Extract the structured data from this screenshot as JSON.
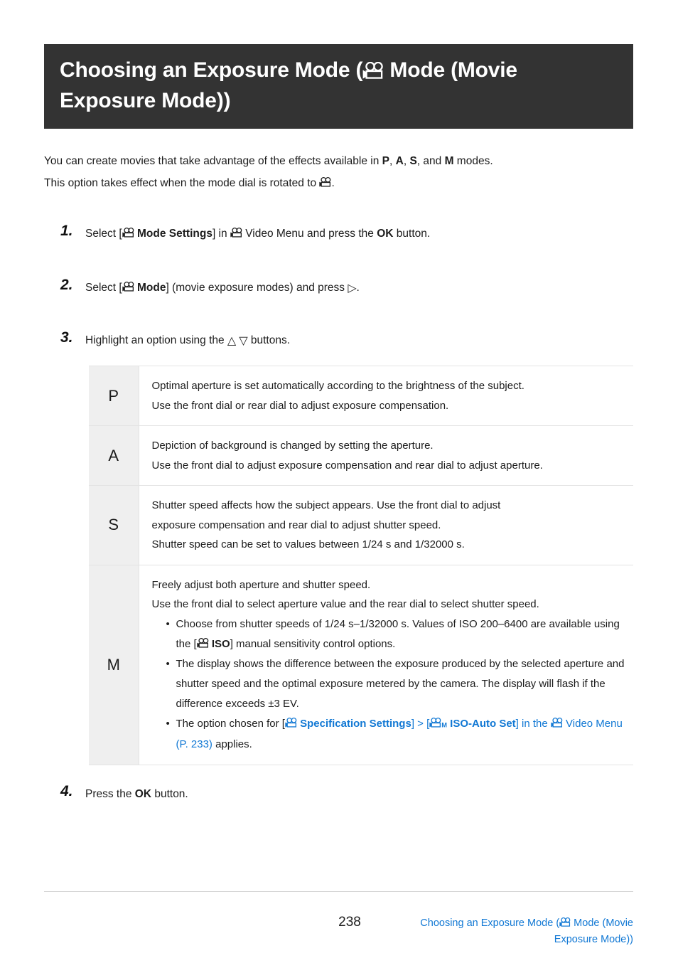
{
  "title": {
    "part1": "Choosing an Exposure Mode (",
    "icon": "movie-camera-icon",
    "part2": " Mode (Movie Exposure Mode))"
  },
  "intro": {
    "line1_a": "You can create movies that take advantage of the effects available in ",
    "mode_p": "P",
    "sep1": ", ",
    "mode_a": "A",
    "sep2": ", ",
    "mode_s": "S",
    "sep3": ", and ",
    "mode_m": "M",
    "line1_b": " modes.",
    "line2_a": "This option takes effect when the mode dial is rotated to ",
    "line2_b": "."
  },
  "steps": [
    {
      "number": "1.",
      "a": "Select [",
      "b": "Mode Settings",
      "c": "] in ",
      "d": " Video Menu and press the ",
      "e": "OK",
      "f": " button."
    },
    {
      "number": "2.",
      "a": "Select [",
      "b": "Mode",
      "c": "] (movie exposure modes) and press ",
      "d": "▷",
      "e": "."
    },
    {
      "number": "3.",
      "a": "Highlight an option using the ",
      "up": "△",
      "down": "▽",
      "b": " buttons."
    },
    {
      "number": "4.",
      "a": "Press the ",
      "b": "OK",
      "c": " button."
    }
  ],
  "table": {
    "rows": [
      {
        "key": "P",
        "lines": [
          "Optimal aperture is set automatically according to the brightness of the subject.",
          "Use the front dial or rear dial to adjust exposure compensation."
        ]
      },
      {
        "key": "A",
        "lines": [
          "Depiction of background is changed by setting the aperture.",
          "Use the front dial to adjust exposure compensation and rear dial to adjust aperture."
        ]
      },
      {
        "key": "S",
        "lines": [
          "Shutter speed affects how the subject appears. Use the front dial to adjust",
          "exposure compensation and rear dial to adjust shutter speed.",
          "Shutter speed can be set to values between 1/24 s and 1/32000 s."
        ]
      },
      {
        "key": "M",
        "lines": [
          "Freely adjust both aperture and shutter speed.",
          "Use the front dial to select aperture value and the rear dial to select shutter speed."
        ],
        "bullets": {
          "b1_a": "Choose from shutter speeds of 1/24 s–1/32000 s. Values of ISO 200–6400 are available using the [",
          "b1_iso": "ISO",
          "b1_b": "] manual sensitivity control options.",
          "b2": "The display shows the difference between the exposure produced by the selected aperture and shutter speed and the optimal exposure metered by the camera. The display will flash if the difference exceeds ±3 EV.",
          "b3_a": "The option chosen for [",
          "b3_spec": "Specification Settings",
          "b3_gt": "] > [",
          "b3_iso_auto": "ISO-Auto Set",
          "b3_b": "] in the ",
          "b3_menu": "Video Menu (P. 233)",
          "b3_c": " applies."
        }
      }
    ]
  },
  "footer": {
    "page_number": "238",
    "link_line1": "Choosing an Exposure Mode (",
    "link_line1_b": " Mode (Movie",
    "link_line2": "Exposure Mode))"
  },
  "colors": {
    "banner_bg": "#333333",
    "link_blue": "#1178d4",
    "table_key_bg": "#efefef",
    "rule": "#d6d6d6"
  }
}
